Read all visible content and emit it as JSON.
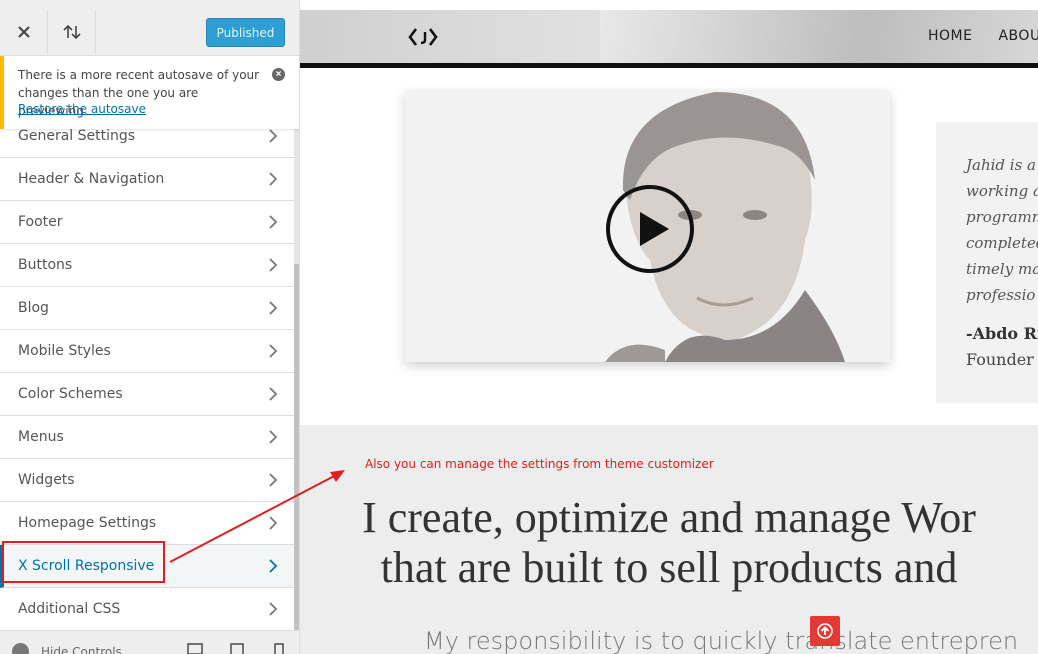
{
  "topbar": {
    "publish_label": "Published"
  },
  "notice": {
    "message": "There is a more recent autosave of your changes than the one you are previewing.",
    "link": "Restore the autosave"
  },
  "panels": [
    {
      "label": "General Settings"
    },
    {
      "label": "Header & Navigation"
    },
    {
      "label": "Footer"
    },
    {
      "label": "Buttons"
    },
    {
      "label": "Blog"
    },
    {
      "label": "Mobile Styles"
    },
    {
      "label": "Color Schemes"
    },
    {
      "label": "Menus"
    },
    {
      "label": "Widgets"
    },
    {
      "label": "Homepage Settings"
    },
    {
      "label": "X Scroll Responsive"
    },
    {
      "label": "Additional CSS"
    }
  ],
  "footer": {
    "hide_controls": "Hide Controls"
  },
  "preview": {
    "nav": [
      "HOME",
      "ABOUT"
    ],
    "quote_lines": [
      "Jahid is a",
      "working a",
      "programm",
      "completed",
      "timely ma",
      "professio"
    ],
    "quote_author": "-Abdo Ria",
    "quote_role": "Founder a",
    "annotation": "Also you can manage the settings from theme customizer",
    "headline_1": "I create, optimize and manage Wor",
    "headline_2": "that are built to sell products and",
    "subline": "My responsibility is to quickly translate entrepren"
  },
  "colors": {
    "accent": "#0073aa",
    "publish": "#2e9fd4",
    "notice_border": "#ffb900",
    "annotation": "#e01e1e",
    "backtop": "#e53935"
  }
}
